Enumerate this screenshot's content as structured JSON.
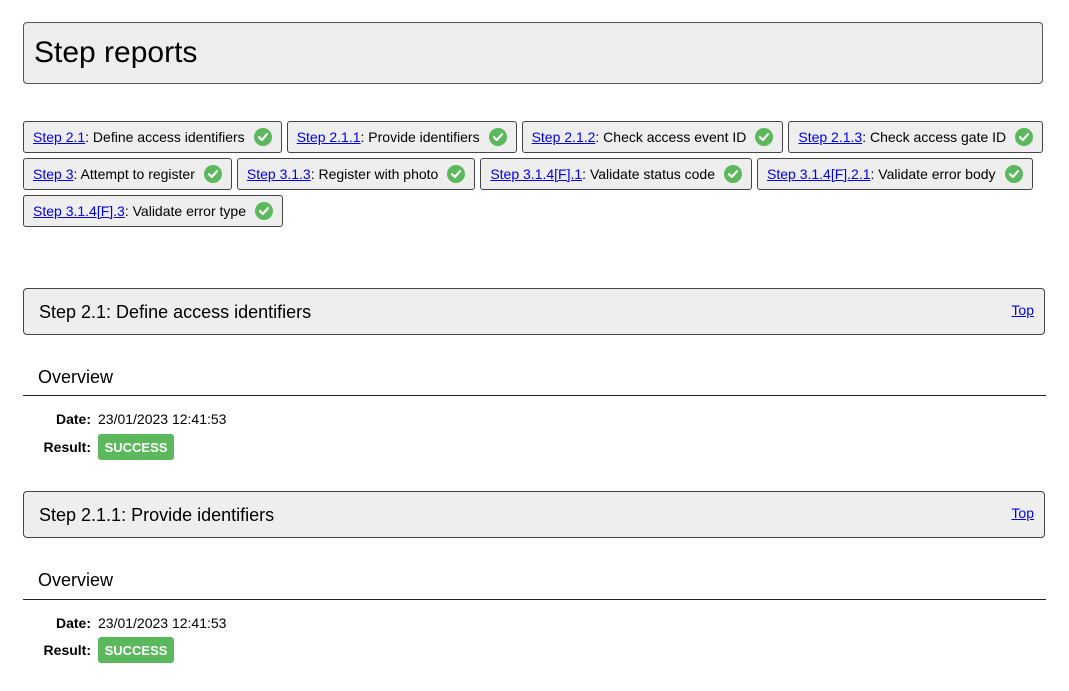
{
  "page": {
    "title": "Step reports"
  },
  "colors": {
    "success": "#5cb85c",
    "link": "#0000ee",
    "panel": "#eeeeee"
  },
  "chips": [
    {
      "link": "Step 2.1",
      "label": ": Define access identifiers",
      "icon": "check-circle-icon"
    },
    {
      "link": "Step 2.1.1",
      "label": ": Provide identifiers",
      "icon": "check-circle-icon"
    },
    {
      "link": "Step 2.1.2",
      "label": ": Check access event ID",
      "icon": "check-circle-icon"
    },
    {
      "link": "Step 2.1.3",
      "label": ": Check access gate ID",
      "icon": "check-circle-icon"
    },
    {
      "link": "Step 3",
      "label": ": Attempt to register",
      "icon": "check-circle-icon"
    },
    {
      "link": "Step 3.1.3",
      "label": ": Register with photo",
      "icon": "check-circle-icon"
    },
    {
      "link": "Step 3.1.4[F].1",
      "label": ": Validate status code",
      "icon": "check-circle-icon"
    },
    {
      "link": "Step 3.1.4[F].2.1",
      "label": ": Validate error body",
      "icon": "check-circle-icon"
    },
    {
      "link": "Step 3.1.4[F].3",
      "label": ": Validate error type",
      "icon": "check-circle-icon"
    }
  ],
  "sections": [
    {
      "title": "Step 2.1: Define access identifiers",
      "top_link": "Top",
      "overview_title": "Overview",
      "date_label": "Date:",
      "date_value": "23/01/2023 12:41:53",
      "result_label": "Result:",
      "result_value": "SUCCESS"
    },
    {
      "title": "Step 2.1.1: Provide identifiers",
      "top_link": "Top",
      "overview_title": "Overview",
      "date_label": "Date:",
      "date_value": "23/01/2023 12:41:53",
      "result_label": "Result:",
      "result_value": "SUCCESS"
    }
  ]
}
